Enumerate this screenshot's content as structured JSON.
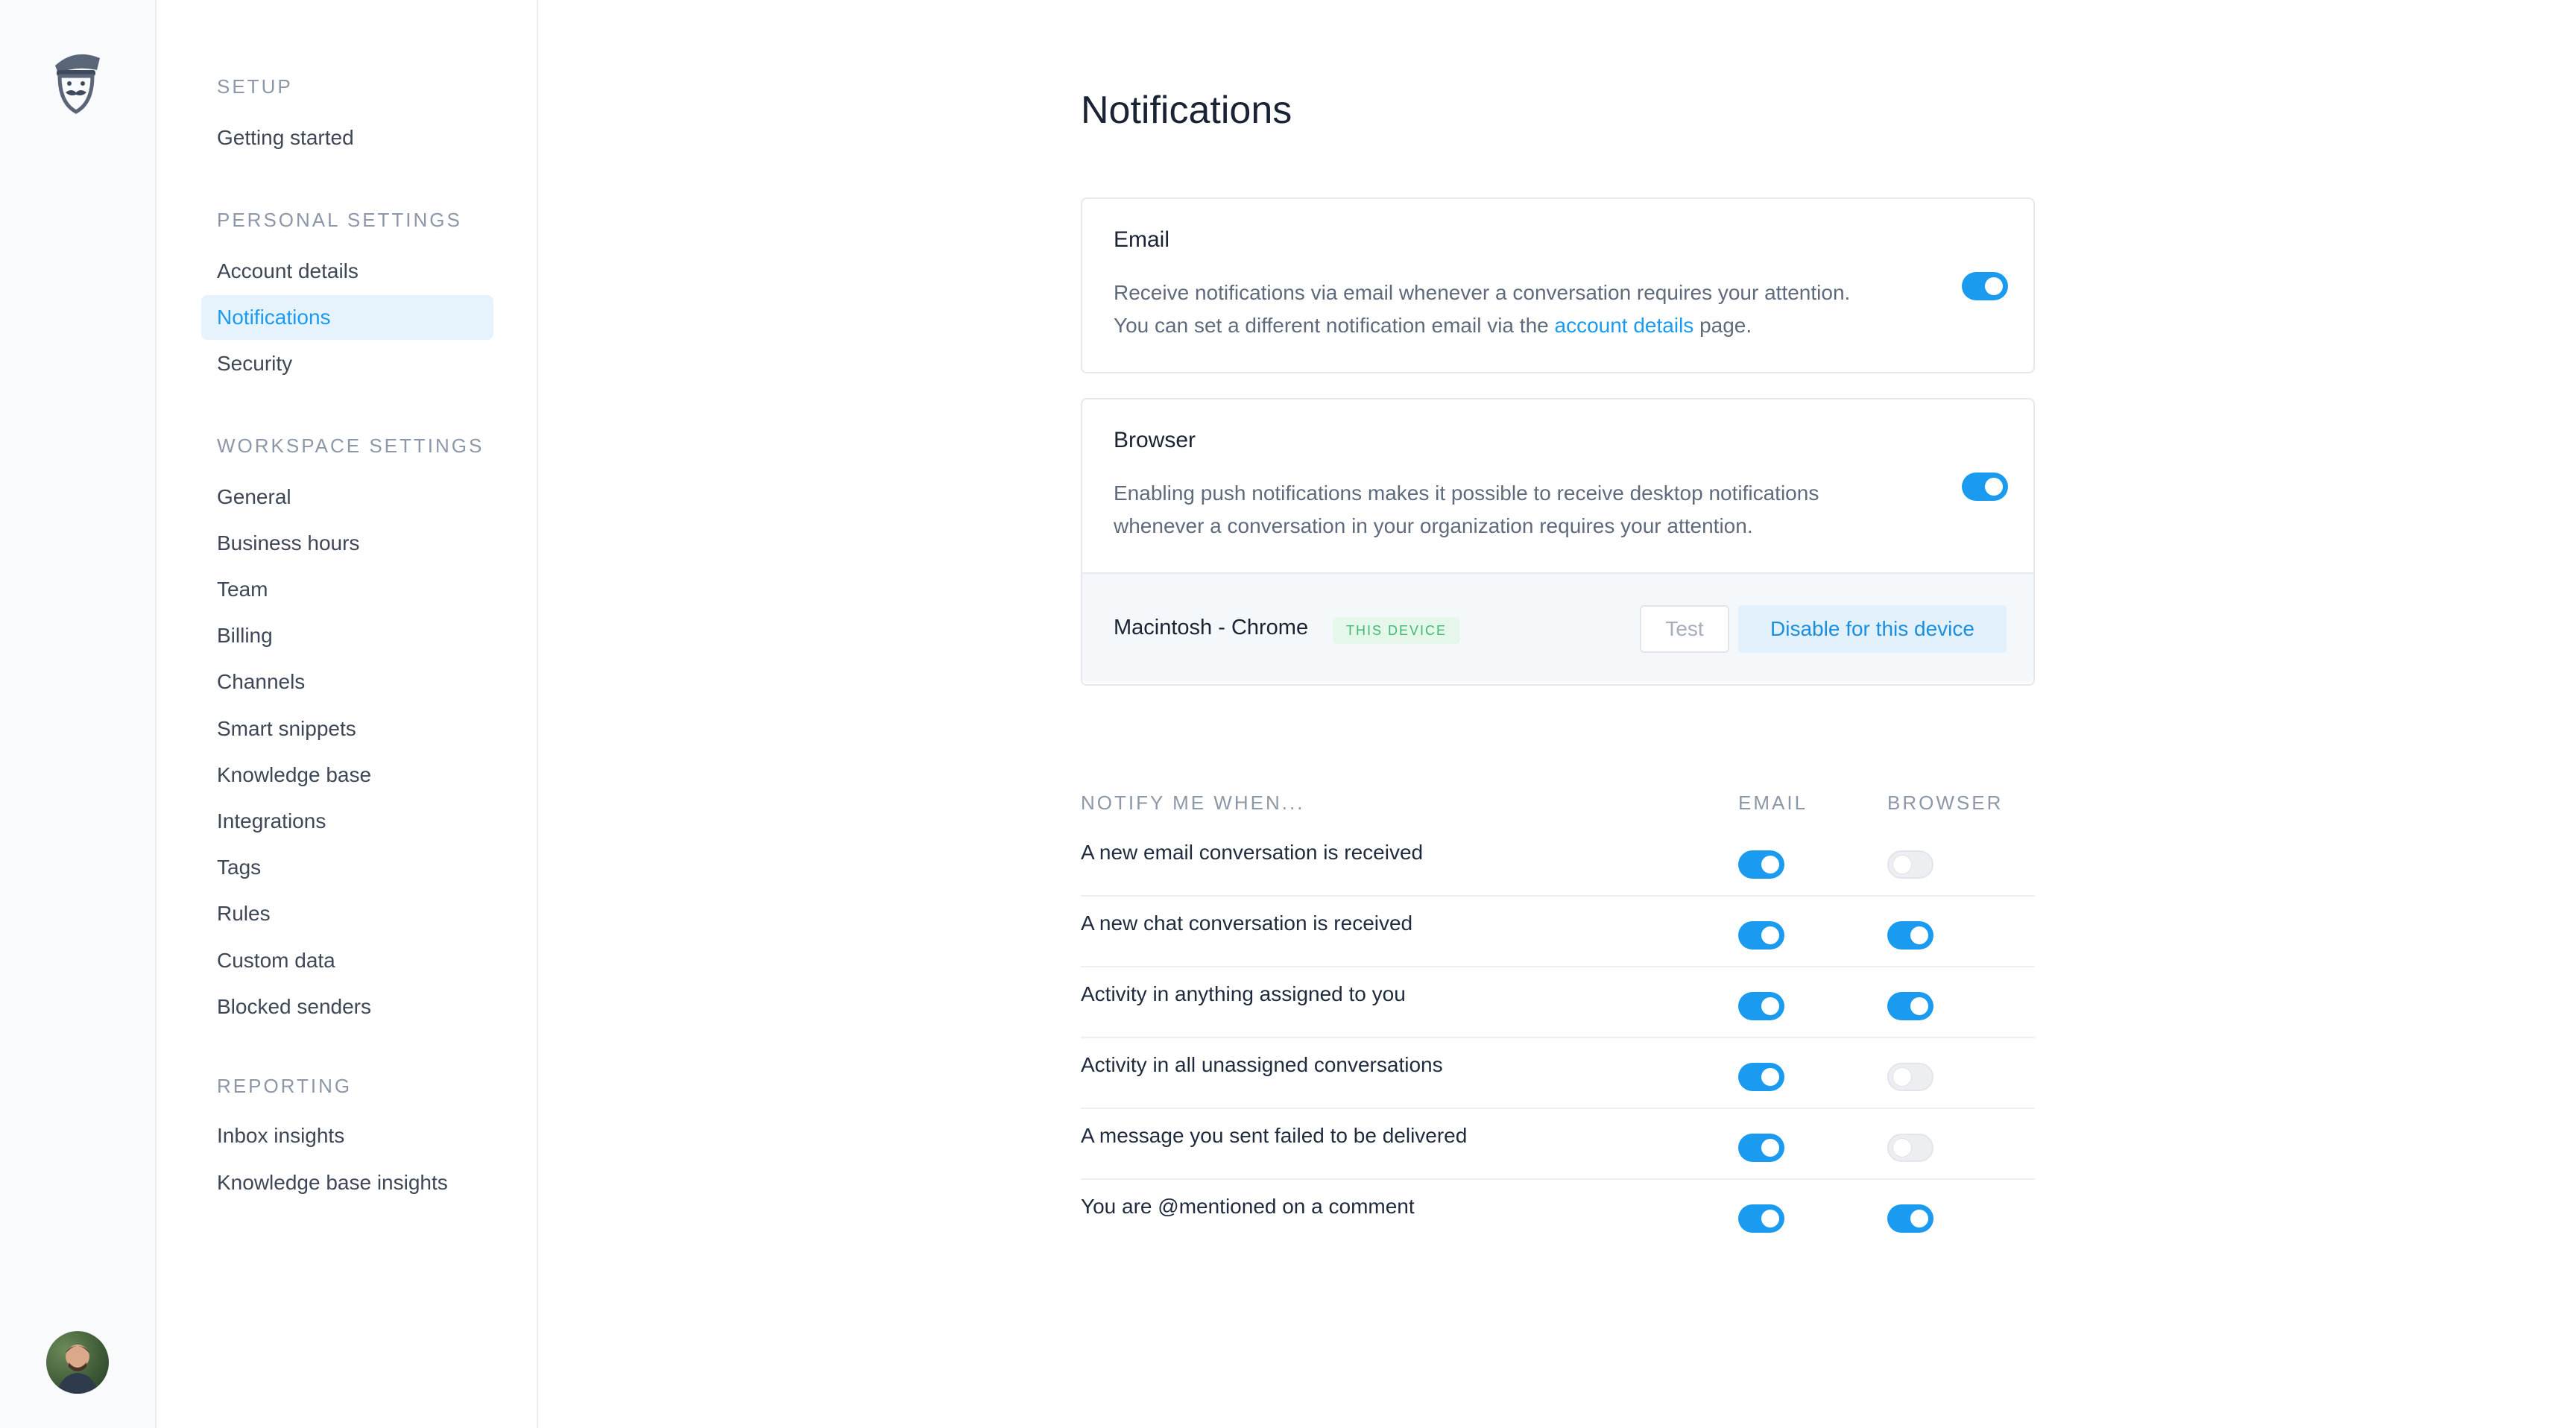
{
  "rail": {
    "logo": "support-agent-logo",
    "avatar": "user-avatar"
  },
  "sidebar": {
    "sections": [
      {
        "title": "SETUP",
        "items": [
          {
            "label": "Getting started"
          }
        ]
      },
      {
        "title": "PERSONAL SETTINGS",
        "items": [
          {
            "label": "Account details"
          },
          {
            "label": "Notifications",
            "active": true
          },
          {
            "label": "Security"
          }
        ]
      },
      {
        "title": "WORKSPACE SETTINGS",
        "items": [
          {
            "label": "General"
          },
          {
            "label": "Business hours"
          },
          {
            "label": "Team"
          },
          {
            "label": "Billing"
          },
          {
            "label": "Channels"
          },
          {
            "label": "Smart snippets"
          },
          {
            "label": "Knowledge base"
          },
          {
            "label": "Integrations"
          },
          {
            "label": "Tags"
          },
          {
            "label": "Rules"
          },
          {
            "label": "Custom data"
          },
          {
            "label": "Blocked senders"
          }
        ]
      },
      {
        "title": "REPORTING",
        "items": [
          {
            "label": "Inbox insights"
          },
          {
            "label": "Knowledge base insights"
          }
        ]
      }
    ]
  },
  "page": {
    "title": "Notifications"
  },
  "email_card": {
    "title": "Email",
    "desc_line1": "Receive notifications via email whenever a conversation requires your attention.",
    "desc_line2_pre": "You can set a different notification email via the ",
    "desc_link": "account details",
    "desc_line2_post": " page.",
    "enabled": true
  },
  "browser_card": {
    "title": "Browser",
    "desc_line1": "Enabling push notifications makes it possible to receive desktop notifications",
    "desc_line2": "whenever a conversation in your organization requires your attention.",
    "enabled": true,
    "device": {
      "name": "Macintosh - Chrome",
      "badge": "THIS DEVICE",
      "test_label": "Test",
      "disable_label": "Disable for this device"
    }
  },
  "notify_table": {
    "headers": {
      "event": "NOTIFY ME WHEN...",
      "email": "EMAIL",
      "browser": "BROWSER"
    },
    "rows": [
      {
        "label": "A new email conversation is received",
        "email": true,
        "browser": false
      },
      {
        "label": "A new chat conversation is received",
        "email": true,
        "browser": true
      },
      {
        "label": "Activity in anything assigned to you",
        "email": true,
        "browser": true
      },
      {
        "label": "Activity in all unassigned conversations",
        "email": true,
        "browser": false
      },
      {
        "label": "A message you sent failed to be delivered",
        "email": true,
        "browser": false
      },
      {
        "label": "You are @mentioned on a comment",
        "email": true,
        "browser": true
      }
    ]
  },
  "colors": {
    "accent": "#1a9bef",
    "active_bg": "#e6f3fd",
    "badge_green": "#3fb871"
  }
}
